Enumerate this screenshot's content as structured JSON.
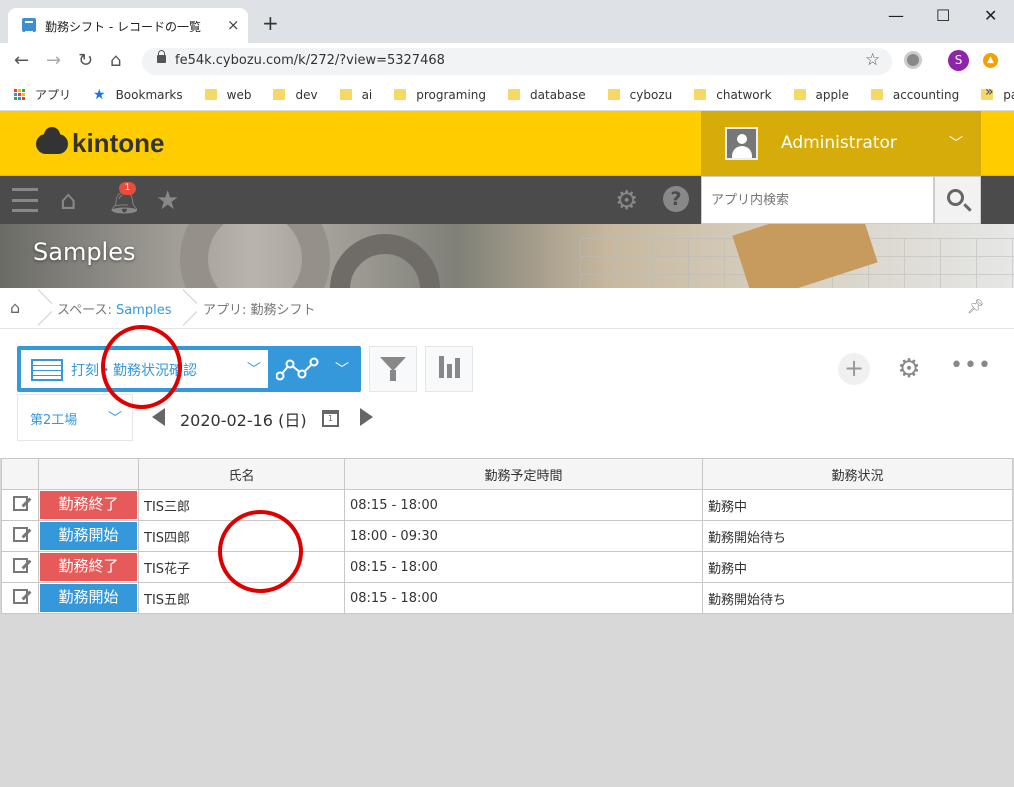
{
  "browser": {
    "tab_title": "勤務シフト - レコードの一覧",
    "tab_close": "×",
    "new_tab": "+",
    "window_minimize": "—",
    "window_maximize": "☐",
    "window_close": "✕",
    "url": "fe54k.cybozu.com/k/272/?view=5327468",
    "profile_initial": "S",
    "bookmarks": [
      {
        "label": "アプリ",
        "icon": "apps-grid-icon"
      },
      {
        "label": "Bookmarks",
        "icon": "star-icon"
      },
      {
        "label": "web",
        "icon": "folder-icon"
      },
      {
        "label": "dev",
        "icon": "folder-icon"
      },
      {
        "label": "ai",
        "icon": "folder-icon"
      },
      {
        "label": "programing",
        "icon": "folder-icon"
      },
      {
        "label": "database",
        "icon": "folder-icon"
      },
      {
        "label": "cybozu",
        "icon": "folder-icon"
      },
      {
        "label": "chatwork",
        "icon": "folder-icon"
      },
      {
        "label": "apple",
        "icon": "folder-icon"
      },
      {
        "label": "accounting",
        "icon": "folder-icon"
      },
      {
        "label": "pay",
        "icon": "folder-icon"
      }
    ]
  },
  "header": {
    "logo": "kintone",
    "user_name": "Administrator",
    "notification_count": "1",
    "search_placeholder": "アプリ内検索"
  },
  "space": {
    "title": "Samples"
  },
  "breadcrumb": {
    "space_prefix": "スペース: ",
    "space_link": "Samples",
    "app": "アプリ: 勤務シフト"
  },
  "view": {
    "selected_view": "打刻・勤務状況確認",
    "filter_value": "第2工場",
    "date": "2020-02-16 (日)",
    "calendar_day": "1"
  },
  "table": {
    "headers": [
      "",
      "",
      "氏名",
      "勤務予定時間",
      "勤務状況"
    ],
    "rows": [
      {
        "action": "勤務終了",
        "action_color": "#e65a5a",
        "name": "TIS三郎",
        "time": "08:15 - 18:00",
        "status": "勤務中"
      },
      {
        "action": "勤務開始",
        "action_color": "#3498db",
        "name": "TIS四郎",
        "time": "18:00 - 09:30",
        "status": "勤務開始待ち"
      },
      {
        "action": "勤務終了",
        "action_color": "#e65a5a",
        "name": "TIS花子",
        "time": "08:15 - 18:00",
        "status": "勤務中"
      },
      {
        "action": "勤務開始",
        "action_color": "#3498db",
        "name": "TIS五郎",
        "time": "08:15 - 18:00",
        "status": "勤務開始待ち"
      }
    ]
  },
  "colors": {
    "header_yellow": "#ffcc00",
    "nav_gray": "#4b4b4b",
    "accent_blue": "#3498db",
    "action_red": "#e65a5a",
    "annotation_red": "#dd0000"
  }
}
